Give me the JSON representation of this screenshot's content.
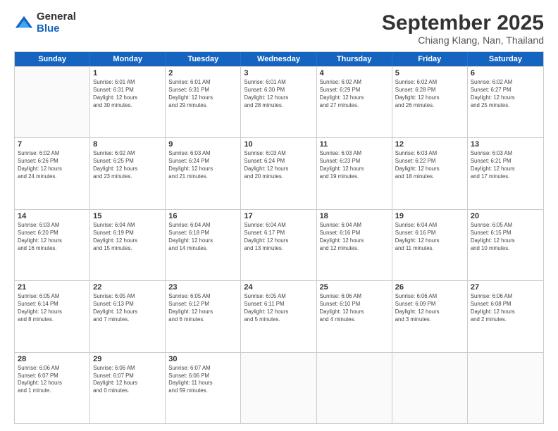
{
  "logo": {
    "general": "General",
    "blue": "Blue"
  },
  "title": "September 2025",
  "location": "Chiang Klang, Nan, Thailand",
  "header": {
    "days": [
      "Sunday",
      "Monday",
      "Tuesday",
      "Wednesday",
      "Thursday",
      "Friday",
      "Saturday"
    ]
  },
  "weeks": [
    [
      {
        "date": "",
        "info": ""
      },
      {
        "date": "1",
        "info": "Sunrise: 6:01 AM\nSunset: 6:31 PM\nDaylight: 12 hours\nand 30 minutes."
      },
      {
        "date": "2",
        "info": "Sunrise: 6:01 AM\nSunset: 6:31 PM\nDaylight: 12 hours\nand 29 minutes."
      },
      {
        "date": "3",
        "info": "Sunrise: 6:01 AM\nSunset: 6:30 PM\nDaylight: 12 hours\nand 28 minutes."
      },
      {
        "date": "4",
        "info": "Sunrise: 6:02 AM\nSunset: 6:29 PM\nDaylight: 12 hours\nand 27 minutes."
      },
      {
        "date": "5",
        "info": "Sunrise: 6:02 AM\nSunset: 6:28 PM\nDaylight: 12 hours\nand 26 minutes."
      },
      {
        "date": "6",
        "info": "Sunrise: 6:02 AM\nSunset: 6:27 PM\nDaylight: 12 hours\nand 25 minutes."
      }
    ],
    [
      {
        "date": "7",
        "info": "Sunrise: 6:02 AM\nSunset: 6:26 PM\nDaylight: 12 hours\nand 24 minutes."
      },
      {
        "date": "8",
        "info": "Sunrise: 6:02 AM\nSunset: 6:25 PM\nDaylight: 12 hours\nand 23 minutes."
      },
      {
        "date": "9",
        "info": "Sunrise: 6:03 AM\nSunset: 6:24 PM\nDaylight: 12 hours\nand 21 minutes."
      },
      {
        "date": "10",
        "info": "Sunrise: 6:03 AM\nSunset: 6:24 PM\nDaylight: 12 hours\nand 20 minutes."
      },
      {
        "date": "11",
        "info": "Sunrise: 6:03 AM\nSunset: 6:23 PM\nDaylight: 12 hours\nand 19 minutes."
      },
      {
        "date": "12",
        "info": "Sunrise: 6:03 AM\nSunset: 6:22 PM\nDaylight: 12 hours\nand 18 minutes."
      },
      {
        "date": "13",
        "info": "Sunrise: 6:03 AM\nSunset: 6:21 PM\nDaylight: 12 hours\nand 17 minutes."
      }
    ],
    [
      {
        "date": "14",
        "info": "Sunrise: 6:03 AM\nSunset: 6:20 PM\nDaylight: 12 hours\nand 16 minutes."
      },
      {
        "date": "15",
        "info": "Sunrise: 6:04 AM\nSunset: 6:19 PM\nDaylight: 12 hours\nand 15 minutes."
      },
      {
        "date": "16",
        "info": "Sunrise: 6:04 AM\nSunset: 6:18 PM\nDaylight: 12 hours\nand 14 minutes."
      },
      {
        "date": "17",
        "info": "Sunrise: 6:04 AM\nSunset: 6:17 PM\nDaylight: 12 hours\nand 13 minutes."
      },
      {
        "date": "18",
        "info": "Sunrise: 6:04 AM\nSunset: 6:16 PM\nDaylight: 12 hours\nand 12 minutes."
      },
      {
        "date": "19",
        "info": "Sunrise: 6:04 AM\nSunset: 6:16 PM\nDaylight: 12 hours\nand 11 minutes."
      },
      {
        "date": "20",
        "info": "Sunrise: 6:05 AM\nSunset: 6:15 PM\nDaylight: 12 hours\nand 10 minutes."
      }
    ],
    [
      {
        "date": "21",
        "info": "Sunrise: 6:05 AM\nSunset: 6:14 PM\nDaylight: 12 hours\nand 8 minutes."
      },
      {
        "date": "22",
        "info": "Sunrise: 6:05 AM\nSunset: 6:13 PM\nDaylight: 12 hours\nand 7 minutes."
      },
      {
        "date": "23",
        "info": "Sunrise: 6:05 AM\nSunset: 6:12 PM\nDaylight: 12 hours\nand 6 minutes."
      },
      {
        "date": "24",
        "info": "Sunrise: 6:05 AM\nSunset: 6:11 PM\nDaylight: 12 hours\nand 5 minutes."
      },
      {
        "date": "25",
        "info": "Sunrise: 6:06 AM\nSunset: 6:10 PM\nDaylight: 12 hours\nand 4 minutes."
      },
      {
        "date": "26",
        "info": "Sunrise: 6:06 AM\nSunset: 6:09 PM\nDaylight: 12 hours\nand 3 minutes."
      },
      {
        "date": "27",
        "info": "Sunrise: 6:06 AM\nSunset: 6:08 PM\nDaylight: 12 hours\nand 2 minutes."
      }
    ],
    [
      {
        "date": "28",
        "info": "Sunrise: 6:06 AM\nSunset: 6:07 PM\nDaylight: 12 hours\nand 1 minute."
      },
      {
        "date": "29",
        "info": "Sunrise: 6:06 AM\nSunset: 6:07 PM\nDaylight: 12 hours\nand 0 minutes."
      },
      {
        "date": "30",
        "info": "Sunrise: 6:07 AM\nSunset: 6:06 PM\nDaylight: 11 hours\nand 59 minutes."
      },
      {
        "date": "",
        "info": ""
      },
      {
        "date": "",
        "info": ""
      },
      {
        "date": "",
        "info": ""
      },
      {
        "date": "",
        "info": ""
      }
    ]
  ]
}
